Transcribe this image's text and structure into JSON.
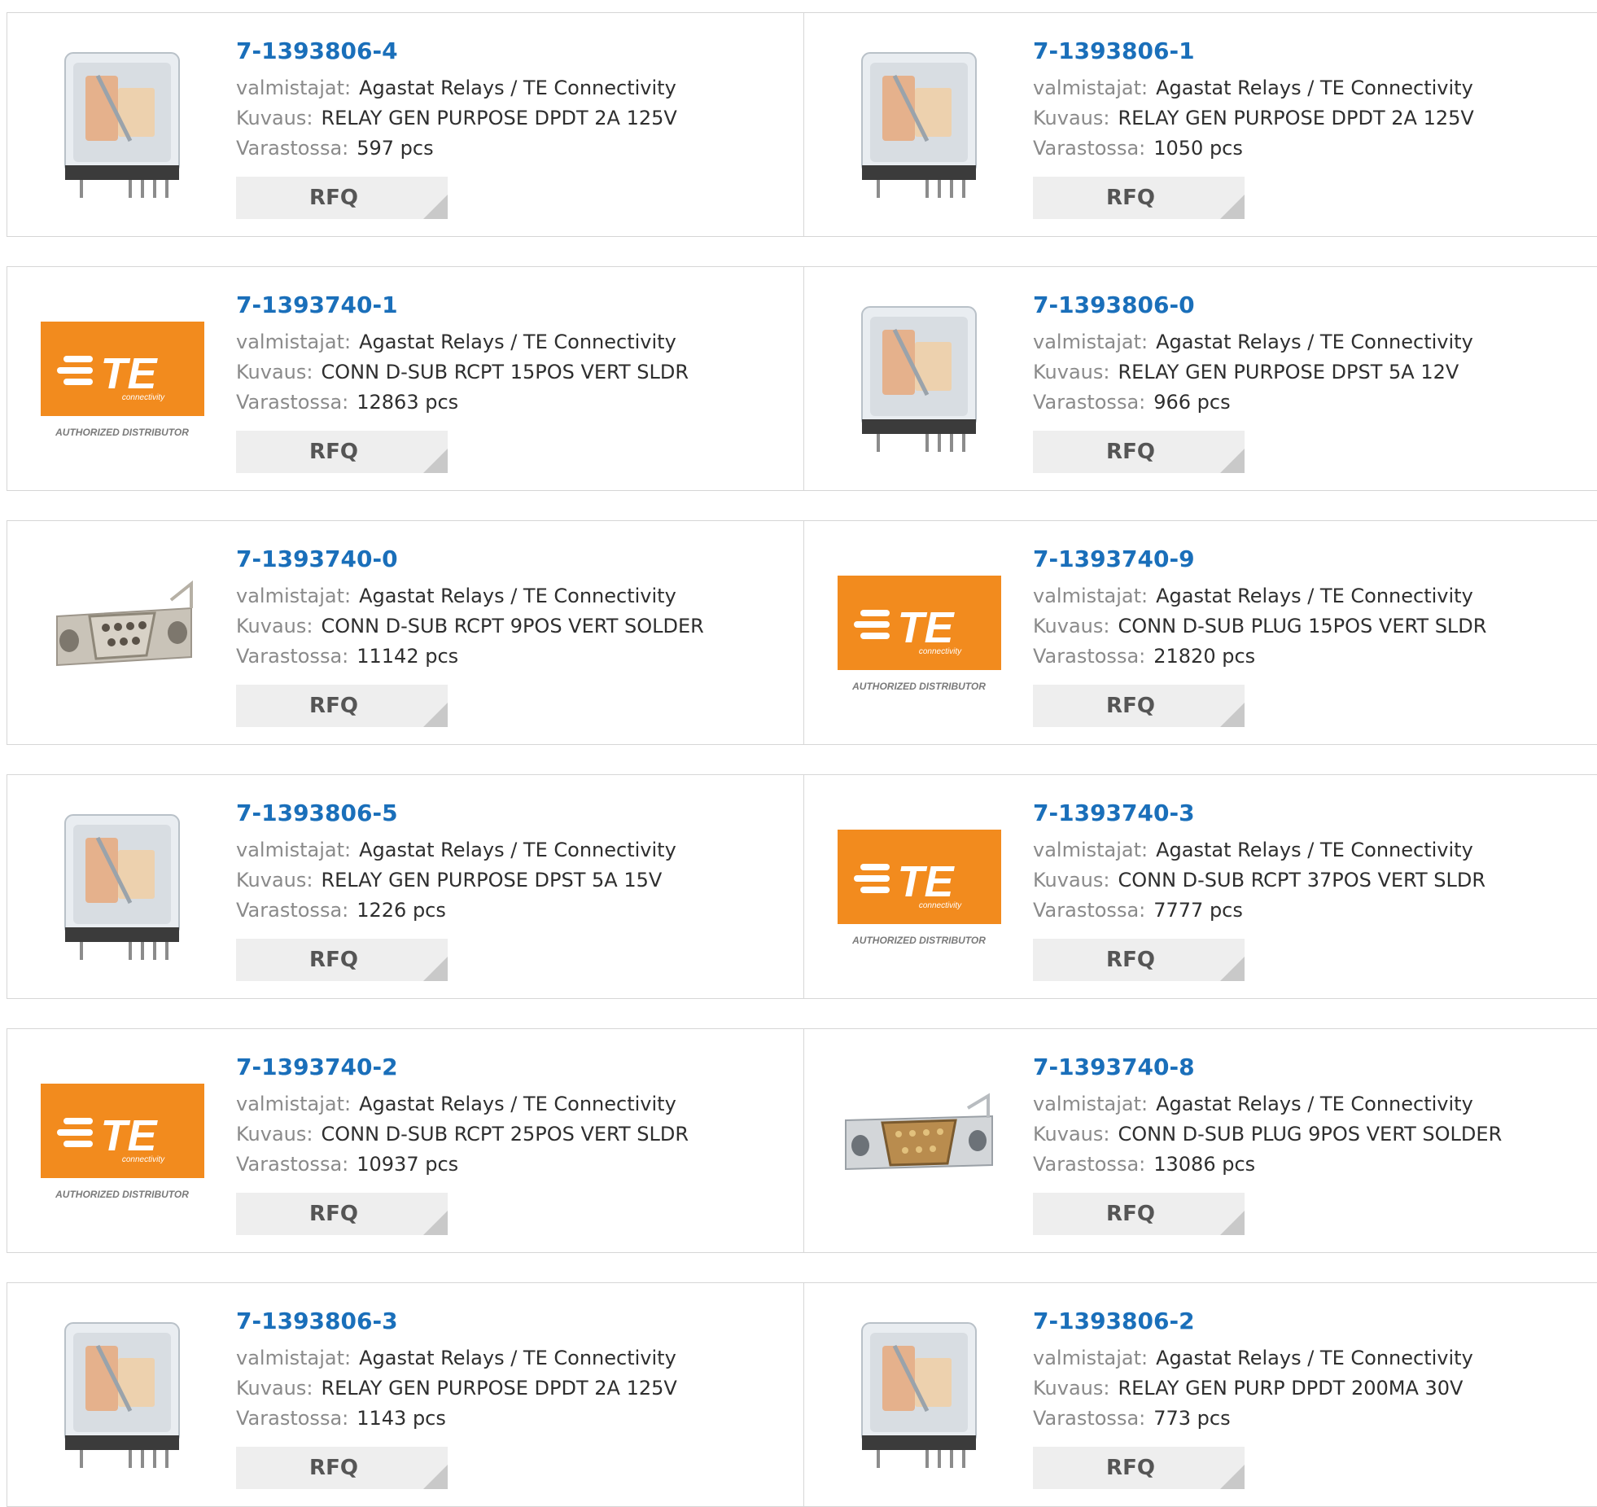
{
  "labels": {
    "manufacturer": "valmistajat:",
    "description": "Kuvaus:",
    "stock": "Varastossa:"
  },
  "te_logo": {
    "brand": "TE",
    "sub": "connectivity",
    "badge": "AUTHORIZED DISTRIBUTOR",
    "color": "#f28b1e"
  },
  "products": [
    {
      "pn": "7-1393806-4",
      "manufacturer": "Agastat Relays / TE Connectivity",
      "description": "RELAY GEN PURPOSE DPDT 2A 125V",
      "stock": "597 pcs",
      "image": "relay-image",
      "rfq": "RFQ"
    },
    {
      "pn": "7-1393806-1",
      "manufacturer": "Agastat Relays / TE Connectivity",
      "description": "RELAY GEN PURPOSE DPDT 2A 125V",
      "stock": "1050 pcs",
      "image": "relay-image",
      "rfq": "RFQ"
    },
    {
      "pn": "7-1393740-1",
      "manufacturer": "Agastat Relays / TE Connectivity",
      "description": "CONN D-SUB RCPT 15POS VERT SLDR",
      "stock": "12863 pcs",
      "image": "te-logo",
      "rfq": "RFQ"
    },
    {
      "pn": "7-1393806-0",
      "manufacturer": "Agastat Relays / TE Connectivity",
      "description": "RELAY GEN PURPOSE DPST 5A 12V",
      "stock": "966 pcs",
      "image": "relay-image",
      "rfq": "RFQ"
    },
    {
      "pn": "7-1393740-0",
      "manufacturer": "Agastat Relays / TE Connectivity",
      "description": "CONN D-SUB RCPT 9POS VERT SOLDER",
      "stock": "11142 pcs",
      "image": "dsub-female-image",
      "rfq": "RFQ"
    },
    {
      "pn": "7-1393740-9",
      "manufacturer": "Agastat Relays / TE Connectivity",
      "description": "CONN D-SUB PLUG 15POS VERT SLDR",
      "stock": "21820 pcs",
      "image": "te-logo",
      "rfq": "RFQ"
    },
    {
      "pn": "7-1393806-5",
      "manufacturer": "Agastat Relays / TE Connectivity",
      "description": "RELAY GEN PURPOSE DPST 5A 15V",
      "stock": "1226 pcs",
      "image": "relay-image",
      "rfq": "RFQ"
    },
    {
      "pn": "7-1393740-3",
      "manufacturer": "Agastat Relays / TE Connectivity",
      "description": "CONN D-SUB RCPT 37POS VERT SLDR",
      "stock": "7777 pcs",
      "image": "te-logo",
      "rfq": "RFQ"
    },
    {
      "pn": "7-1393740-2",
      "manufacturer": "Agastat Relays / TE Connectivity",
      "description": "CONN D-SUB RCPT 25POS VERT SLDR",
      "stock": "10937 pcs",
      "image": "te-logo",
      "rfq": "RFQ"
    },
    {
      "pn": "7-1393740-8",
      "manufacturer": "Agastat Relays / TE Connectivity",
      "description": "CONN D-SUB PLUG 9POS VERT SOLDER",
      "stock": "13086 pcs",
      "image": "dsub-male-image",
      "rfq": "RFQ"
    },
    {
      "pn": "7-1393806-3",
      "manufacturer": "Agastat Relays / TE Connectivity",
      "description": "RELAY GEN PURPOSE DPDT 2A 125V",
      "stock": "1143 pcs",
      "image": "relay-image",
      "rfq": "RFQ"
    },
    {
      "pn": "7-1393806-2",
      "manufacturer": "Agastat Relays / TE Connectivity",
      "description": "RELAY GEN PURP DPDT 200MA 30V",
      "stock": "773 pcs",
      "image": "relay-image",
      "rfq": "RFQ"
    }
  ]
}
